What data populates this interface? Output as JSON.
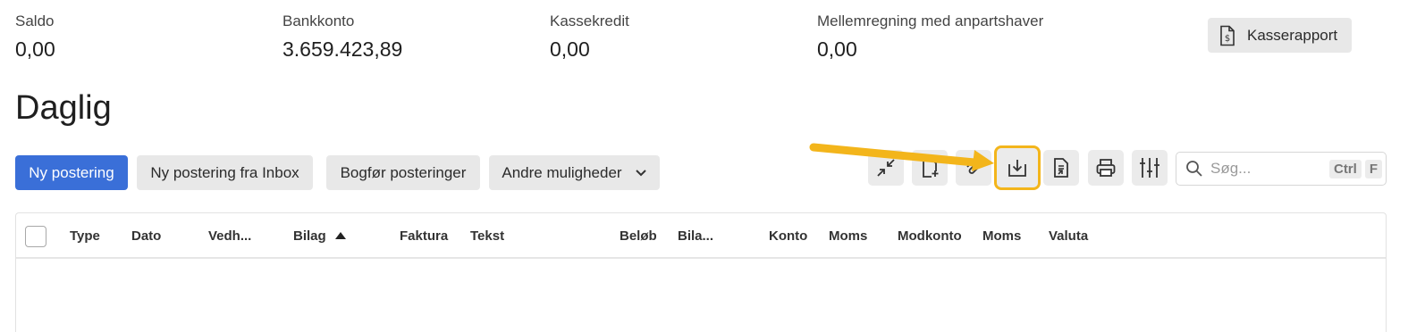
{
  "balances": [
    {
      "label": "Saldo",
      "value": "0,00"
    },
    {
      "label": "Bankkonto",
      "value": "3.659.423,89"
    },
    {
      "label": "Kassekredit",
      "value": "0,00"
    },
    {
      "label": "Mellemregning med anpartshaver",
      "value": "0,00"
    }
  ],
  "report_button": {
    "label": "Kasserapport",
    "icon": "dollar-document-icon"
  },
  "page_title": "Daglig",
  "actions": {
    "new_posting": "Ny postering",
    "new_from_inbox": "Ny postering fra Inbox",
    "post_entries": "Bogfør posteringer",
    "other_options": "Andre muligheder"
  },
  "toolbar_icons": [
    "collapse-icon",
    "add-document-icon",
    "attach-icon",
    "import-icon",
    "export-document-icon",
    "print-icon",
    "column-settings-icon"
  ],
  "highlight_color": "#f3b51b",
  "search": {
    "placeholder": "Søg...",
    "shortcut_ctrl": "Ctrl",
    "shortcut_key": "F"
  },
  "table": {
    "columns": [
      "Type",
      "Dato",
      "Vedh...",
      "Bilag",
      "Faktura",
      "Tekst",
      "Beløb",
      "Bila...",
      "Konto",
      "Moms",
      "Modkonto",
      "Moms",
      "Valuta"
    ]
  },
  "colors": {
    "primary": "#3a6fd8",
    "secondary_bg": "#e8e8e8"
  }
}
